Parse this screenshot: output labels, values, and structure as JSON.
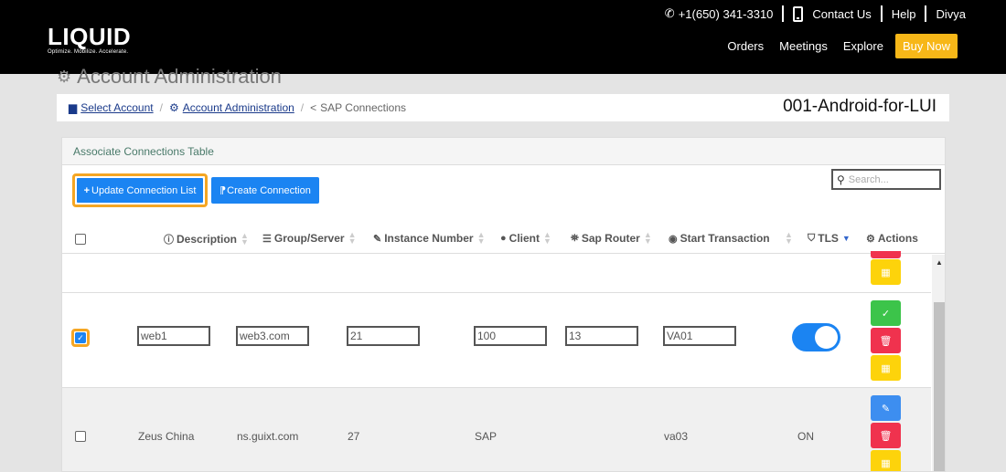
{
  "header": {
    "logo_text": "LIQUID",
    "logo_tagline": "Optimize. Mobilize. Accelerate.",
    "phone": "+1(650) 341-3310",
    "contact_label": "Contact Us",
    "help_label": "Help",
    "user_name": "Divya",
    "nav": [
      "Orders",
      "Meetings",
      "Explore"
    ],
    "buy_label": "Buy Now"
  },
  "page": {
    "title": "Account Administration",
    "breadcrumbs": {
      "select_account": "Select Account",
      "account_admin": "Account Administration",
      "current": "SAP Connections"
    },
    "account_code": "001-Android-for-LUI"
  },
  "panel": {
    "title": "Associate Connections Table",
    "update_button": "Update Connection List",
    "create_button": "Create Connection",
    "search_placeholder": "Search...",
    "columns": {
      "description": "Description",
      "group_server": "Group/Server",
      "instance_number": "Instance Number",
      "client": "Client",
      "sap_router": "Sap Router",
      "start_transaction": "Start Transaction",
      "tls": "TLS",
      "actions": "Actions"
    },
    "edit_row": {
      "checked": true,
      "description": "web1",
      "group_server": "web3.com",
      "instance_number": "21",
      "client": "100",
      "sap_router": "13",
      "start_transaction": "VA01",
      "tls_on": true
    },
    "row3": {
      "description": "Zeus China",
      "group_server": "ns.guixt.com",
      "instance_number": "27",
      "client": "SAP",
      "sap_router": "",
      "start_transaction": "va03",
      "tls": "ON"
    }
  },
  "colors": {
    "accent_blue": "#1b84f2",
    "highlight_orange": "#f5a623",
    "buy_yellow": "#f7b718",
    "delete_red": "#f0324e",
    "action_yellow": "#fdd30b",
    "save_green": "#3cc44a"
  }
}
